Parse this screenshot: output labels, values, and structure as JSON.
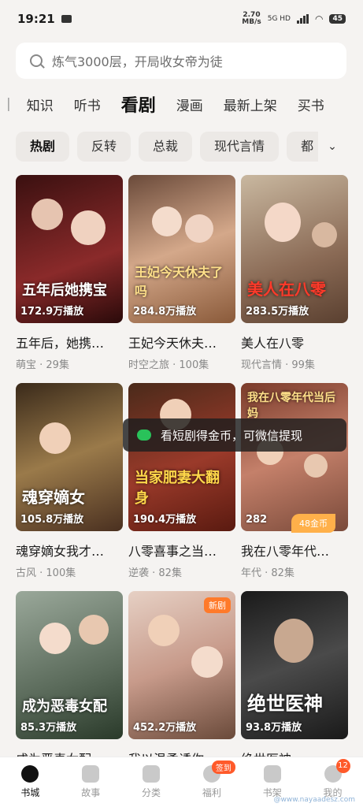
{
  "status": {
    "time": "19:21",
    "speed_top": "2.70",
    "speed_unit": "MB/s",
    "signal": "5G HD",
    "battery": "45"
  },
  "search": {
    "placeholder": "炼气3000层，开局收女帝为徒"
  },
  "tabs": [
    "知识",
    "听书",
    "看剧",
    "漫画",
    "最新上架",
    "买书"
  ],
  "active_tab": "看剧",
  "chips": [
    "热剧",
    "反转",
    "总裁",
    "现代言情",
    "都"
  ],
  "cards": [
    {
      "title": "五年后，她携…",
      "meta": "萌宝 · 29集",
      "plays": "172.9万播放",
      "art": "五年后她携宝",
      "bg": "#5a1e1e"
    },
    {
      "title": "王妃今天休夫…",
      "meta": "时空之旅 · 100集",
      "plays": "284.8万播放",
      "art": "王妃今天休夫了吗",
      "bg": "#b07a5a"
    },
    {
      "title": "美人在八零",
      "meta": "现代言情 · 99集",
      "plays": "283.5万播放",
      "art": "美人在八零",
      "bg": "#8a6a55"
    },
    {
      "title": "魂穿嫡女我才…",
      "meta": "古风 · 100集",
      "plays": "105.8万播放",
      "art": "魂穿嫡女",
      "bg": "#6a4a2a"
    },
    {
      "title": "八零喜事之当…",
      "meta": "逆袭 · 82集",
      "plays": "190.4万播放",
      "art": "当家肥妻大翻身",
      "bg": "#8a2a22"
    },
    {
      "title": "我在八零年代…",
      "meta": "年代 · 82集",
      "plays": "282",
      "art": "我在八零年代当后妈",
      "bg": "#9a5a4a"
    },
    {
      "title": "成为恶毒女配",
      "meta": "",
      "plays": "85.3万播放",
      "art": "成为恶毒女配",
      "bg": "#6a7a6a"
    },
    {
      "title": "我以温柔诱你",
      "meta": "",
      "plays": "452.2万播放",
      "art": "",
      "bg": "#c79a8a",
      "badge": "新剧"
    },
    {
      "title": "绝世医神",
      "meta": "",
      "plays": "93.8万播放",
      "art": "绝世医神",
      "bg": "#2a2a2a"
    }
  ],
  "toast": "看短剧得金币，可微信提现",
  "coin_badge": "48金币",
  "bottom_nav": [
    {
      "label": "书城",
      "icon": "compass-icon",
      "active": true
    },
    {
      "label": "故事",
      "icon": "story-icon"
    },
    {
      "label": "分类",
      "icon": "category-icon"
    },
    {
      "label": "福利",
      "icon": "gift-icon",
      "tag": "签到"
    },
    {
      "label": "书架",
      "icon": "bookshelf-icon"
    },
    {
      "label": "我的",
      "icon": "profile-icon",
      "count": "12"
    }
  ],
  "watermark": "@www.nayaadesz.com"
}
